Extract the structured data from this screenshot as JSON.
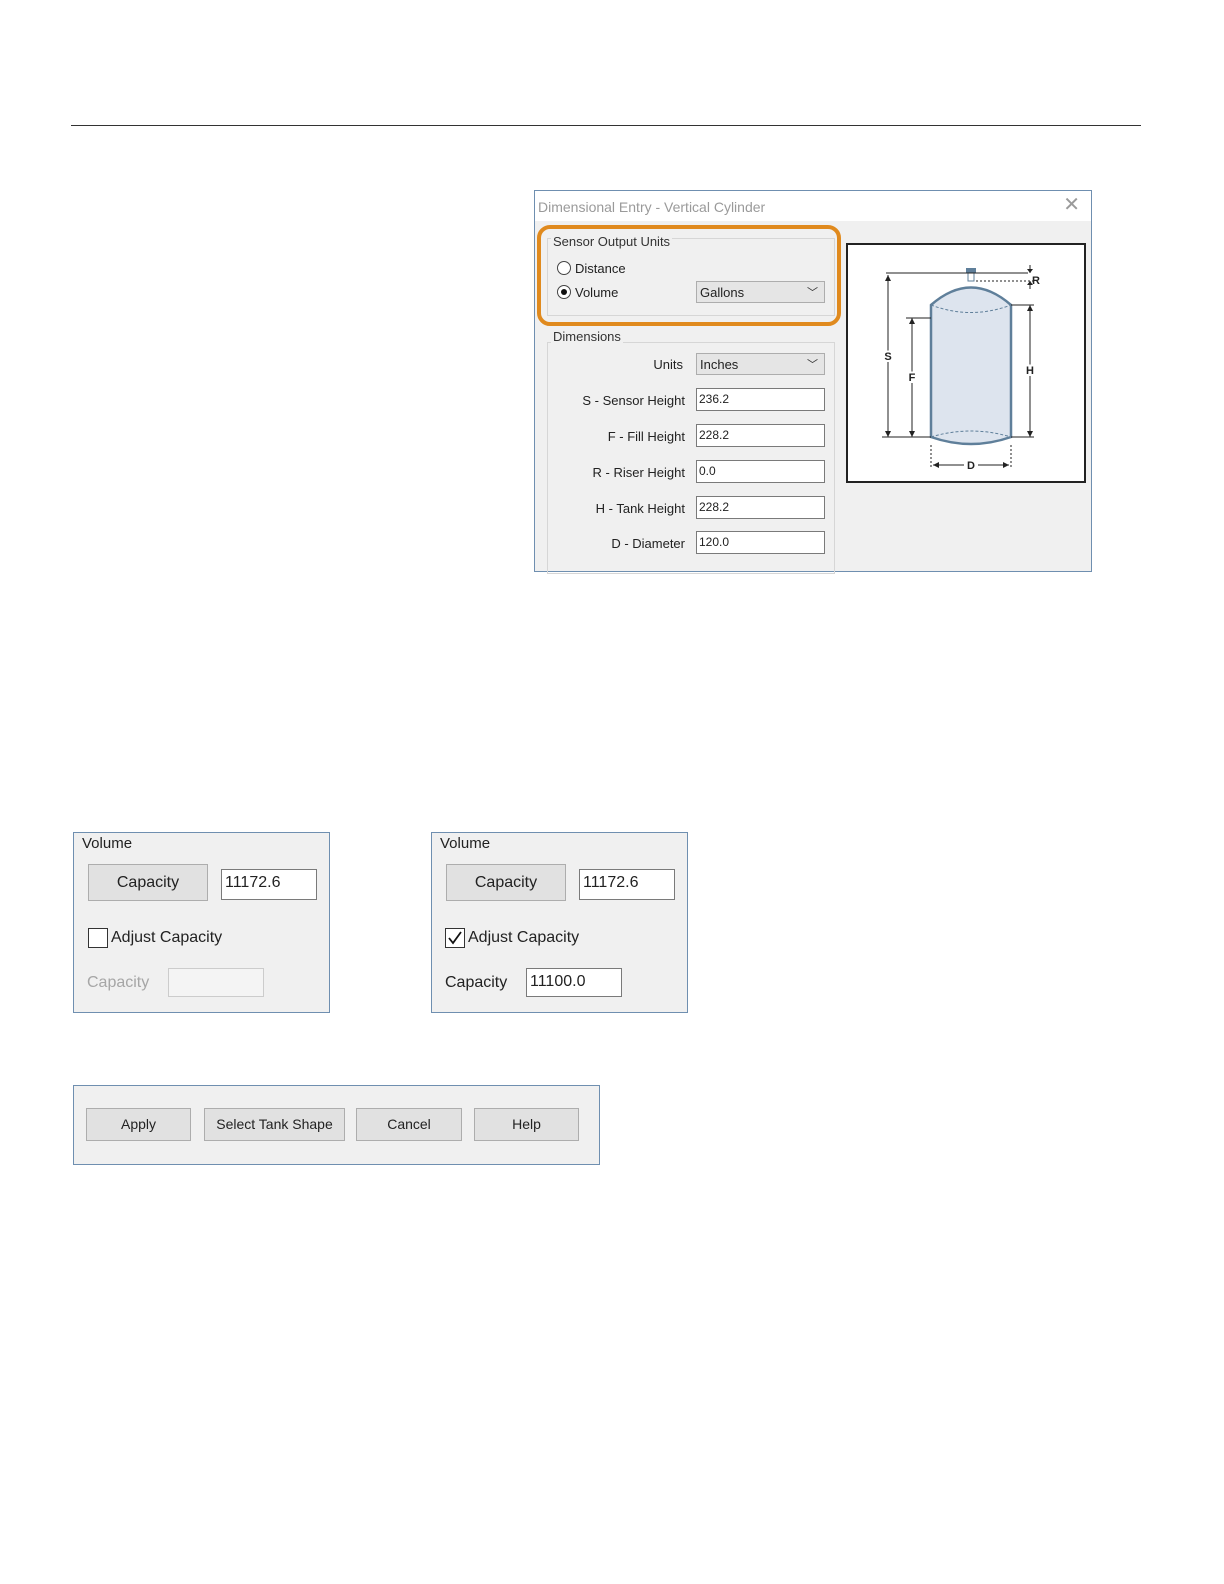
{
  "dialog": {
    "title": "Dimensional Entry - Vertical Cylinder",
    "close_glyph": "✕",
    "sensor_output": {
      "group_label": "Sensor Output Units",
      "distance_label": "Distance",
      "volume_label": "Volume",
      "selected": "Volume",
      "volume_units": "Gallons"
    },
    "dimensions": {
      "group_label": "Dimensions",
      "units_label": "Units",
      "units_value": "Inches",
      "fields": [
        {
          "label": "S - Sensor Height",
          "value": "236.2"
        },
        {
          "label": "F - Fill Height",
          "value": "228.2"
        },
        {
          "label": "R - Riser Height",
          "value": "0.0"
        },
        {
          "label": "H - Tank Height",
          "value": "228.2"
        },
        {
          "label": "D - Diameter",
          "value": "120.0"
        }
      ]
    },
    "diagram_labels": {
      "s": "S",
      "f": "F",
      "h": "H",
      "r": "R",
      "d": "D"
    },
    "dropdown_icon": "chevron-down-icon",
    "highlight_color": "#e08a1e"
  },
  "volume_unchecked": {
    "title": "Volume",
    "capacity_button": "Capacity",
    "capacity_value": "11172.6",
    "adjust_label": "Adjust Capacity",
    "adjust_checked": false,
    "capacity_label": "Capacity",
    "capacity_input": ""
  },
  "volume_checked": {
    "title": "Volume",
    "capacity_button": "Capacity",
    "capacity_value": "11172.6",
    "adjust_label": "Adjust Capacity",
    "adjust_checked": true,
    "capacity_label": "Capacity",
    "capacity_input": "11100.0"
  },
  "button_bar": {
    "apply": "Apply",
    "select_tank_shape": "Select Tank Shape",
    "cancel": "Cancel",
    "help": "Help"
  }
}
